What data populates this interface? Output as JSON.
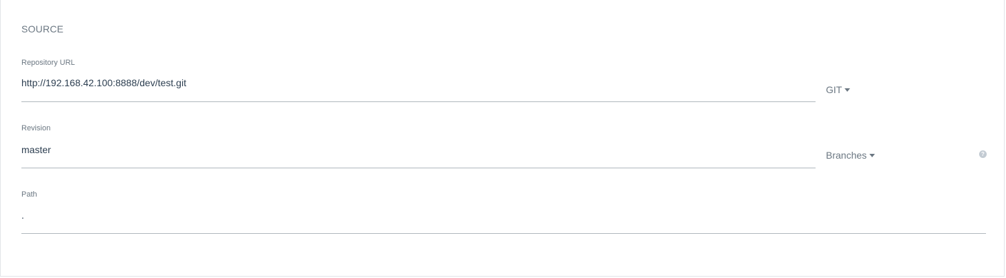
{
  "section": {
    "title": "SOURCE"
  },
  "repository": {
    "label": "Repository URL",
    "value": "http://192.168.42.100:8888/dev/test.git",
    "type_label": "GIT"
  },
  "revision": {
    "label": "Revision",
    "value": "master",
    "mode_label": "Branches",
    "help_icon": "help-icon",
    "help_glyph": "?"
  },
  "path": {
    "label": "Path",
    "value": "."
  },
  "icons": {
    "dropdown": "chevron-down-icon",
    "help": "question-circle-icon"
  },
  "colors": {
    "label": "#6b7782",
    "text": "#2c3e50",
    "underline": "#b0b7bd",
    "help_bg": "#c3cbd3"
  }
}
